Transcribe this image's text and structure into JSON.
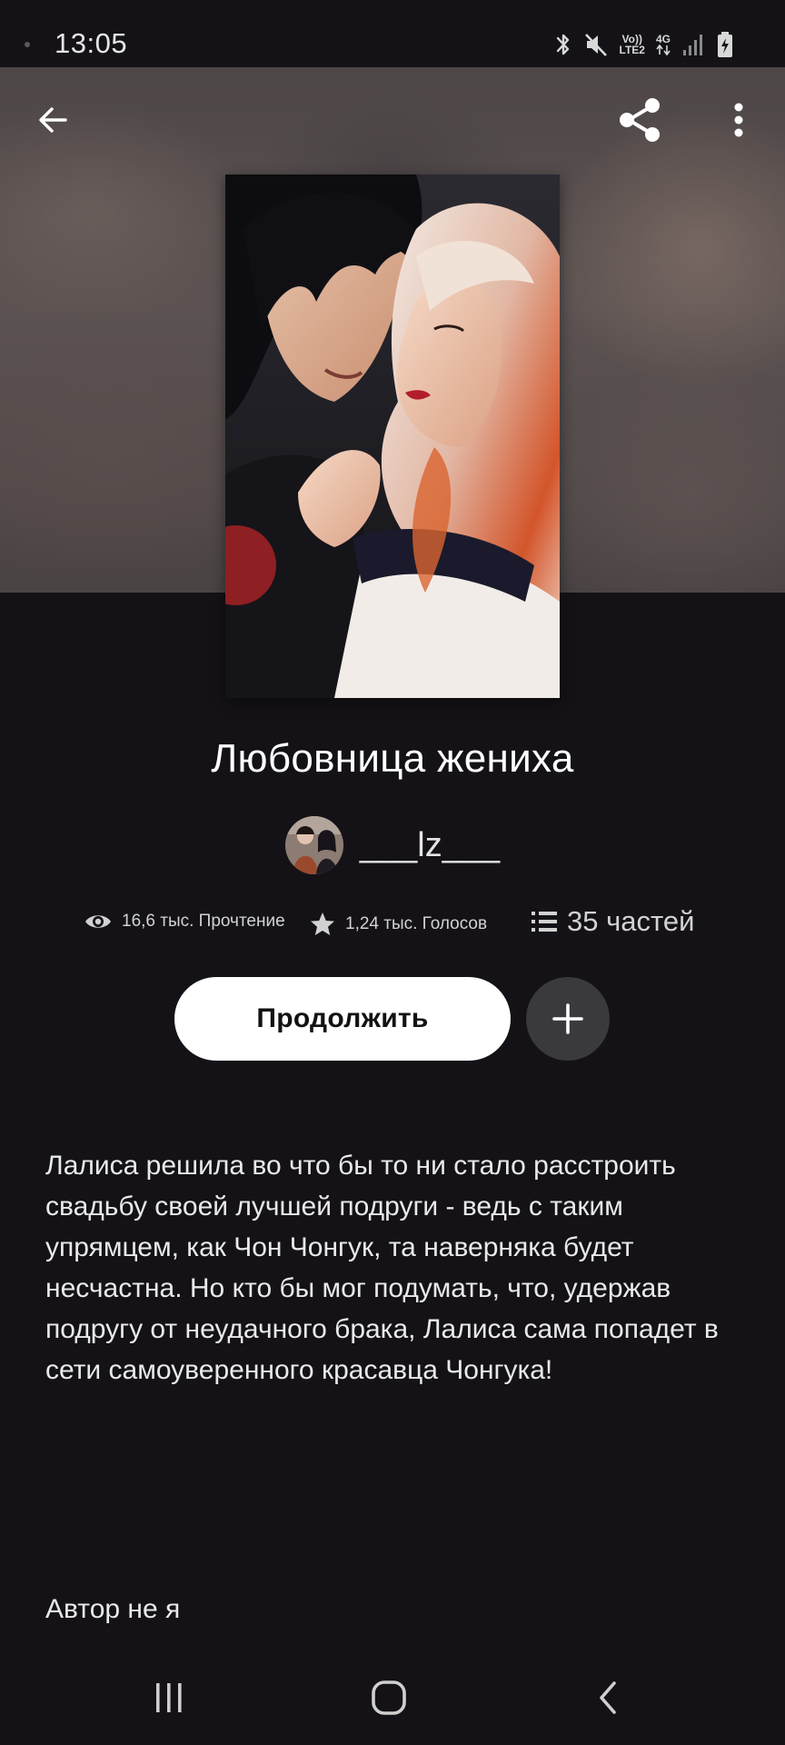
{
  "status_bar": {
    "time": "13:05",
    "network_top": "Vo))",
    "network_bottom": "LTE2",
    "network_gen": "4G",
    "icons": [
      "bluetooth-icon",
      "mute-icon",
      "signal-icon",
      "battery-charging-icon"
    ]
  },
  "toolbar": {
    "back_icon": "arrow-left-icon",
    "share_icon": "share-icon",
    "more_icon": "more-vertical-icon"
  },
  "story": {
    "title": "Любовница жениха",
    "author": "___lz___",
    "stats": {
      "reads": "16,6 тыс. Прочтение",
      "votes": "1,24 тыс. Голосов",
      "parts": "35 частей"
    },
    "continue_label": "Продолжить",
    "add_icon": "plus-icon",
    "description": "Лалиса решила во что бы то ни стало расстроить свадьбу своей лучшей подруги - ведь с таким упрямцем, как Чон Чонгук, та наверняка будет несчастна. Но кто бы мог подумать, что, удержав подругу от неудачного брака, Лалиса сама попадет в сети самоуверенного красавца Чонгука!",
    "author_note": "Автор не я"
  },
  "nav_bar": {
    "recent_icon": "recent-apps-icon",
    "home_icon": "home-icon",
    "back_icon": "back-icon"
  },
  "colors": {
    "background": "#141216",
    "button_primary": "#ffffff",
    "button_secondary": "#3a393d",
    "text": "#ffffff"
  }
}
